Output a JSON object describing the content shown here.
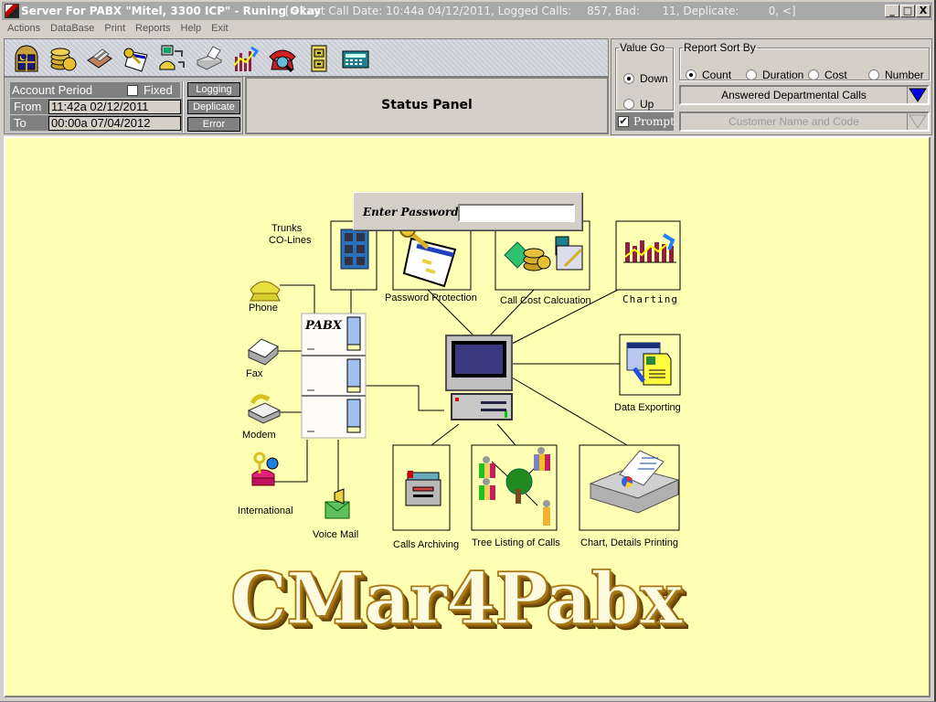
{
  "window": {
    "title": "Server For PABX  \"Mitel, 3300 ICP\"  - Runing Okay",
    "status_prefix": "[> Last Call Date: 10:44a 04/12/2011, Logged Calls:",
    "logged_calls": "857",
    "bad_label": ", Bad:",
    "bad": "11",
    "deplicate_label": ", Deplicate:",
    "deplicate": "0",
    "status_suffix": ", <]",
    "minimize": "_",
    "maximize": "□",
    "close": "X"
  },
  "menu": [
    "Actions",
    "DataBase",
    "Print",
    "Reports",
    "Help",
    "Exit"
  ],
  "toolbar": {
    "icons": [
      "night-window-icon",
      "coins-icon",
      "card-file-icon",
      "password-key-icon",
      "phone-computer-icon",
      "fax-printer-icon",
      "chart-icon",
      "phone-search-icon",
      "file-cabinet-icon",
      "calculator-icon"
    ]
  },
  "account": {
    "period_label": "Account Period",
    "fixed_label": "Fixed",
    "fixed_checked": false,
    "from_label": "From",
    "from_value": "11:42a 02/12/2011",
    "to_label": "To",
    "to_value": "00:00a 07/04/2012",
    "buttons": [
      "Logging",
      "Deplicate",
      "Error"
    ]
  },
  "status_panel": {
    "label": "Status Panel"
  },
  "value_go": {
    "legend": "Value Go",
    "options": [
      "Down",
      "Up"
    ],
    "selected": "Down"
  },
  "report_sort": {
    "legend": "Report Sort By",
    "options": [
      "Count",
      "Duration",
      "Cost",
      "Number"
    ],
    "selected": "Count"
  },
  "report_type": {
    "selected": "Answered Departmental Calls"
  },
  "prompt": {
    "label": "Prompt",
    "checked": true
  },
  "report_filter": {
    "selected": "Customer Name and Code",
    "disabled": true
  },
  "password_dialog": {
    "label": "Enter Password",
    "value": ""
  },
  "diagram": {
    "trunks_line1": "Trunks",
    "trunks_line2": "CO-Lines",
    "phone": "Phone",
    "fax": "Fax",
    "modem": "Modem",
    "international": "International",
    "voice_mail": "Voice Mail",
    "pabx": "PABX",
    "password_protection": "Password Protection",
    "call_cost": "Call Cost Calcuation",
    "charting": "Charting",
    "data_exporting": "Data Exporting",
    "calls_archiving": "Calls Archiving",
    "tree_listing": "Tree Listing of Calls",
    "printing": "Chart, Details Printing"
  },
  "logo": "CMar4Pabx"
}
